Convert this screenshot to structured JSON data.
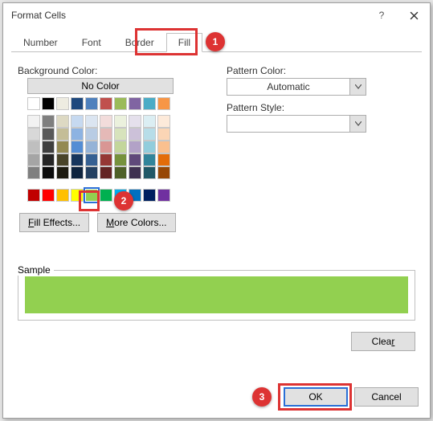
{
  "title": "Format Cells",
  "tabs": [
    "Number",
    "Font",
    "Border",
    "Fill"
  ],
  "active_tab": "Fill",
  "labels": {
    "bg": "Background Color:",
    "nocolor": "No Color",
    "patcolor": "Pattern Color:",
    "patstyle": "Pattern Style:",
    "sample": "Sample",
    "fill_effects_pre": "F",
    "fill_effects_rest": "ill Effects...",
    "more_colors_pre": "M",
    "more_colors_rest": "ore Colors...",
    "pat_auto": "Automatic",
    "clear_pre": "C",
    "clear_rest": "lea",
    "clear_post": "r"
  },
  "buttons": {
    "ok": "OK",
    "cancel": "Cancel"
  },
  "callouts": {
    "c1": "1",
    "c2": "2",
    "c3": "3"
  },
  "palette_theme": [
    [
      "#ffffff",
      "#000000",
      "#eeece1",
      "#1f497d",
      "#4f81bd",
      "#c0504d",
      "#9bbb59",
      "#8064a2",
      "#4bacc6",
      "#f79646"
    ],
    [
      "#f2f2f2",
      "#7f7f7f",
      "#ddd9c3",
      "#c6d9f0",
      "#dbe5f1",
      "#f2dcdb",
      "#ebf1dd",
      "#e5e0ec",
      "#dbeef3",
      "#fdeada"
    ],
    [
      "#d8d8d8",
      "#595959",
      "#c4bd97",
      "#8db3e2",
      "#b8cce4",
      "#e5b9b7",
      "#d7e3bc",
      "#ccc1d9",
      "#b7dde8",
      "#fbd5b5"
    ],
    [
      "#bfbfbf",
      "#3f3f3f",
      "#938953",
      "#548dd4",
      "#95b3d7",
      "#d99694",
      "#c3d69b",
      "#b2a2c7",
      "#92cddc",
      "#fac08f"
    ],
    [
      "#a5a5a5",
      "#262626",
      "#494429",
      "#17365d",
      "#366092",
      "#953734",
      "#76923c",
      "#5f497a",
      "#31859b",
      "#e36c09"
    ],
    [
      "#7f7f7f",
      "#0c0c0c",
      "#1d1b10",
      "#0f243e",
      "#244061",
      "#632423",
      "#4f6128",
      "#3f3151",
      "#205867",
      "#974806"
    ]
  ],
  "palette_std": [
    "#c00000",
    "#ff0000",
    "#ffc000",
    "#ffff00",
    "#92d050",
    "#00b050",
    "#00b0f0",
    "#0070c0",
    "#002060",
    "#7030a0"
  ],
  "selected_std_index": 4,
  "chart_data": {
    "type": "table",
    "title": "Format Cells — Fill tab selections",
    "selected_color": "#92d050",
    "pattern_color": "Automatic",
    "pattern_style": ""
  }
}
